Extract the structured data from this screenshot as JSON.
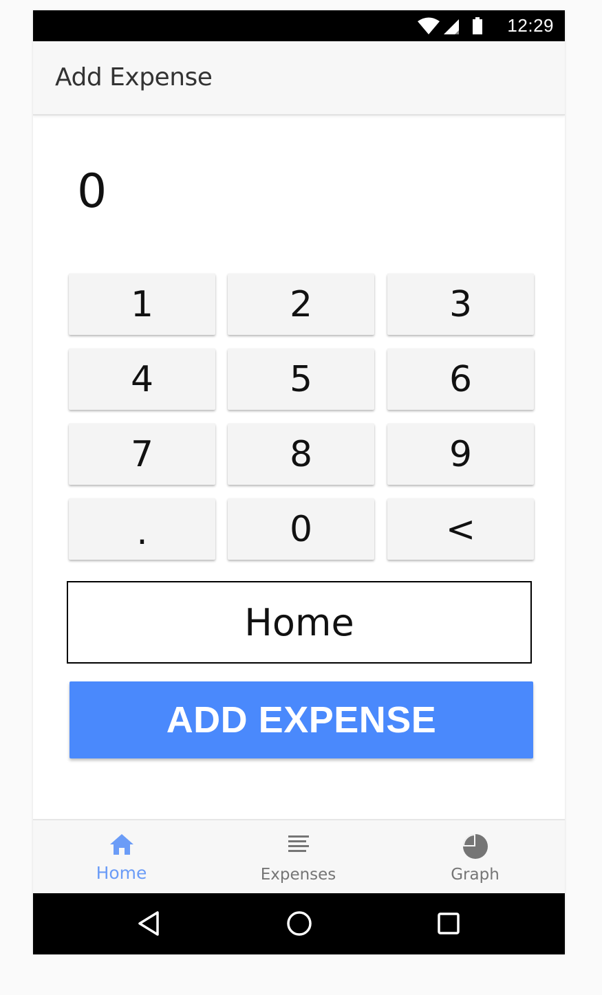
{
  "status_bar": {
    "time": "12:29",
    "icons": [
      "wifi-icon",
      "cell-signal-icon",
      "battery-icon"
    ]
  },
  "app_bar": {
    "title": "Add Expense"
  },
  "amount": {
    "value": "0"
  },
  "keypad": {
    "keys": [
      "1",
      "2",
      "3",
      "4",
      "5",
      "6",
      "7",
      "8",
      "9",
      ".",
      "0",
      "<"
    ]
  },
  "category": {
    "value": "Home"
  },
  "add_button": {
    "label": "ADD EXPENSE",
    "color": "#4a89fc"
  },
  "bottom_nav": {
    "items": [
      {
        "label": "Home",
        "icon": "home-icon",
        "active": true
      },
      {
        "label": "Expenses",
        "icon": "list-icon",
        "active": false
      },
      {
        "label": "Graph",
        "icon": "pie-chart-icon",
        "active": false
      }
    ],
    "active_color": "#6b9cf7",
    "inactive_color": "#757575"
  },
  "system_nav": {
    "buttons": [
      "back-icon",
      "home-circle-icon",
      "recents-icon"
    ]
  }
}
